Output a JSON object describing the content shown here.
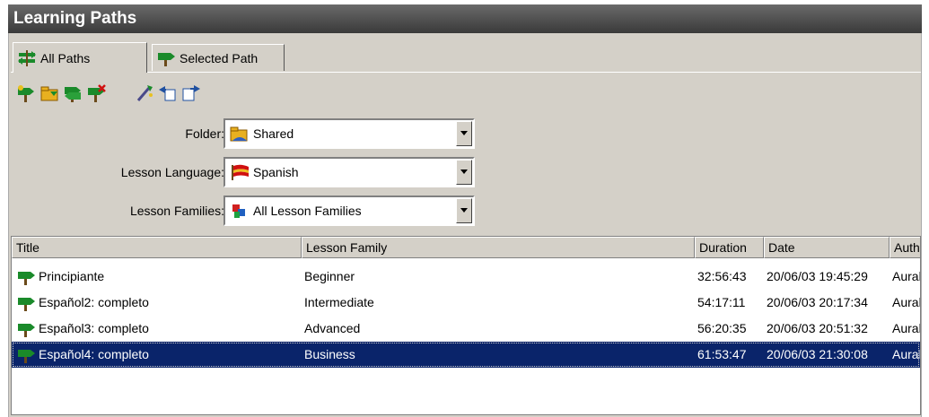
{
  "window": {
    "title": "Learning Paths"
  },
  "tabs": [
    {
      "label": "All Paths",
      "icon": "paths-icon",
      "active": true
    },
    {
      "label": "Selected Path",
      "icon": "signpost-icon",
      "active": false
    }
  ],
  "toolbar": {
    "buttons": [
      {
        "name": "new-path-button",
        "icon": "signpost-add-icon"
      },
      {
        "name": "open-path-button",
        "icon": "folder-icon"
      },
      {
        "name": "copy-path-button",
        "icon": "signpost-copy-icon"
      },
      {
        "name": "delete-path-button",
        "icon": "signpost-delete-icon"
      },
      {
        "name": "edit-path-button",
        "icon": "wand-icon"
      },
      {
        "name": "import-path-button",
        "icon": "import-icon"
      },
      {
        "name": "export-path-button",
        "icon": "export-icon"
      }
    ]
  },
  "filters": {
    "folder": {
      "label": "Folder:",
      "value": "Shared",
      "icon": "folder-shared-icon"
    },
    "language": {
      "label": "Lesson Language:",
      "value": "Spanish",
      "icon": "spain-flag-icon"
    },
    "families": {
      "label": "Lesson Families:",
      "value": "All Lesson Families",
      "icon": "lesson-families-icon"
    }
  },
  "table": {
    "columns": [
      "Title",
      "Lesson Family",
      "Duration",
      "Date",
      "Author"
    ],
    "rows": [
      {
        "title": "Principiante",
        "family": "Beginner",
        "duration": "32:56:43",
        "date": "20/06/03 19:45:29",
        "author": "Aural"
      },
      {
        "title": "Español2: completo",
        "family": "Intermediate",
        "duration": "54:17:11",
        "date": "20/06/03 20:17:34",
        "author": "Aural"
      },
      {
        "title": "Español3: completo",
        "family": "Advanced",
        "duration": "56:20:35",
        "date": "20/06/03 20:51:32",
        "author": "Aural"
      },
      {
        "title": "Español4: completo",
        "family": "Business",
        "duration": "61:53:47",
        "date": "20/06/03 21:30:08",
        "author": "Aural"
      }
    ],
    "selected_row": 3
  },
  "colors": {
    "selection": "#0a246a",
    "face": "#d4d0c8",
    "titlebar": "#4a4a4a",
    "sign_green": "#1a8a2a"
  }
}
